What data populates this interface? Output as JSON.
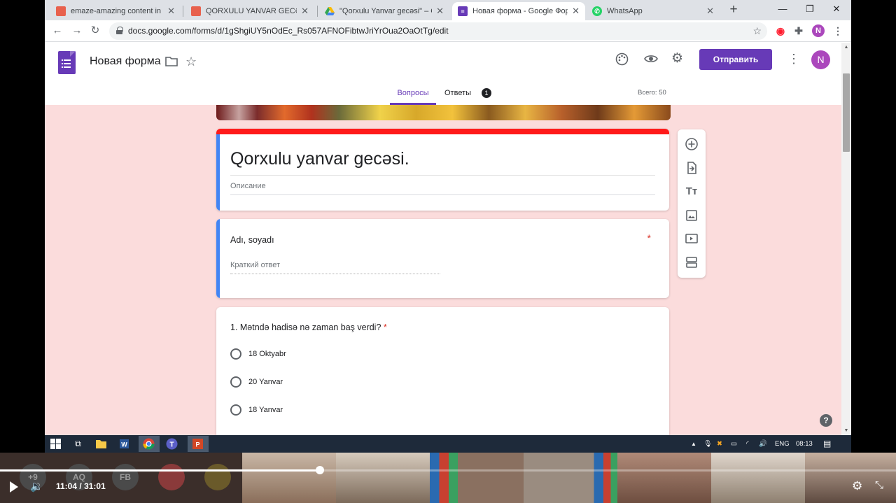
{
  "browser": {
    "tabs": [
      {
        "title": "emaze-amazing content in mi",
        "close": "✕",
        "fav_color": "#e8614d"
      },
      {
        "title": "QORXULU YANVAR GECƏSİ by",
        "close": "✕",
        "fav_color": "#e8614d"
      },
      {
        "title": "\"Qorxulu Yanvar gecəsi\" – Goo",
        "close": "✕",
        "fav_color": "#34a853"
      },
      {
        "title": "Новая форма - Google Формы",
        "close": "✕",
        "fav_color": "#673ab7"
      },
      {
        "title": "WhatsApp",
        "close": "✕",
        "fav_color": "#25d366"
      }
    ],
    "new_tab": "+",
    "url": "docs.google.com/forms/d/1gShgiUY5nOdEc_Rs057AFNOFibtwJriYrOua2OaOtTg/edit",
    "profile_initial": "N"
  },
  "forms": {
    "doc_title": "Новая форма",
    "send_label": "Отправить",
    "avatar_initial": "N",
    "tab_questions": "Вопросы",
    "tab_responses": "Ответы",
    "responses_count": "1",
    "total_points": "Всего: 50",
    "form_title": "Qorxulu yanvar gecəsi.",
    "description_placeholder": "Описание",
    "questions": [
      {
        "title": "Adı, soyadı",
        "required_mark": "*",
        "answer_placeholder": "Краткий ответ"
      },
      {
        "title": "1. Mətndə hadisə nə zaman baş verdi?",
        "required_mark": "*",
        "options": [
          "18 Oktyabr",
          "20 Yanvar",
          "18 Yanvar"
        ]
      }
    ],
    "help": "?"
  },
  "taskbar": {
    "language": "ENG",
    "clock": "08:13"
  },
  "player": {
    "current_time": "11:04",
    "separator": "/",
    "duration": "31:01",
    "progress_fraction": 0.357,
    "participants": [
      "+9",
      "AQ",
      "FB"
    ]
  },
  "colors": {
    "accent_purple": "#673ab7",
    "title_bar_red": "#ff1a1a",
    "side_blue": "#4285f4",
    "form_bg": "#fbdcdc"
  }
}
